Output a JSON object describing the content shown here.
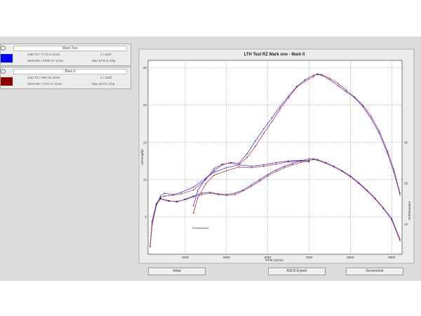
{
  "legend": [
    {
      "title": "Mark Two",
      "line1": "23577S / 77.41 5 1/min",
      "line1_right": "1 / 1027",
      "line2": "3578 Min / kW/h 97 1/min",
      "line2_right": "Max 5/7/4 9 1/hp",
      "color": "#0000ff"
    },
    {
      "title": "Mark II",
      "line1": "34177S / 79/2 05 1/min",
      "line1_right": "1 / 1025",
      "line2": "3578 Min / 77/2 17 1/min",
      "line2_right": "Max 8/27/1 1/hp",
      "color": "#8b0000"
    }
  ],
  "buttons": {
    "initial": "Initial",
    "ascii": "ASCII Export",
    "screenshot": "Screenshot"
  },
  "chart_data": {
    "type": "line",
    "title": "LTH Test RZ Mark one - Mark II",
    "xlabel": "RPM (1/min)",
    "ylabel": "Leistung/hp",
    "ylabel_right": "Drehmoment",
    "annotation": "Drehmoment",
    "xlim": [
      3100,
      9250
    ],
    "ylim": [
      0,
      26
    ],
    "x_ticks": [
      4000,
      5000,
      6000,
      7000,
      8000,
      9000
    ],
    "y_ticks": [
      5,
      10,
      15,
      20,
      25
    ],
    "y_tick_labels": [
      "5",
      "10",
      "15",
      "20",
      "25"
    ],
    "y_right_ticks": [
      4,
      9.5,
      15
    ],
    "y_right_tick_labels": [
      "10",
      "20",
      "30"
    ],
    "grid": true,
    "series": [
      {
        "color": "#3b3bff",
        "x": [
          3150,
          3200,
          3300,
          3400,
          3500,
          3700,
          3900,
          4200,
          4500,
          4700,
          4900,
          5100,
          5300,
          5500,
          5700,
          5900,
          6100,
          6300,
          6500,
          6700,
          6900,
          7100,
          7200,
          7300,
          7500,
          7700,
          7900,
          8100,
          8300,
          8500,
          8700,
          8900,
          9050,
          9200
        ],
        "y": [
          1,
          4,
          6.5,
          7.8,
          8.2,
          8.0,
          8.3,
          9.0,
          10.2,
          11.2,
          12.0,
          12.3,
          12.2,
          13.5,
          15.2,
          16.8,
          18.3,
          19.8,
          21.2,
          22.5,
          23.4,
          24.0,
          24.1,
          24.0,
          23.4,
          22.6,
          21.8,
          21.0,
          19.8,
          18.2,
          16.2,
          13.5,
          11.0,
          8.0
        ]
      },
      {
        "color": "#cc3333",
        "x": [
          3150,
          3200,
          3300,
          3400,
          3500,
          3700,
          3900,
          4200,
          4500,
          4700,
          4900,
          5100,
          5300,
          5500,
          5700,
          5900,
          6100,
          6300,
          6500,
          6700,
          6900,
          7100,
          7200,
          7300,
          7500,
          7700,
          7900,
          8100,
          8300,
          8500,
          8700,
          8900,
          9050,
          9200
        ],
        "y": [
          1,
          4.2,
          6.8,
          7.6,
          7.8,
          7.9,
          8.1,
          8.6,
          10.0,
          11.5,
          12.1,
          12.2,
          12.0,
          13.0,
          14.5,
          16.2,
          17.8,
          19.5,
          21.0,
          22.4,
          23.2,
          23.8,
          24.2,
          24.1,
          23.6,
          22.9,
          22.0,
          21.1,
          20.0,
          18.5,
          16.5,
          13.8,
          11.4,
          8.2
        ]
      },
      {
        "color": "#3b3bff",
        "x": [
          3150,
          3200,
          3300,
          3400,
          3600,
          3800,
          4000,
          4200,
          4400,
          4600,
          4800,
          5000,
          5200,
          5400,
          5600,
          5800,
          6000,
          6200,
          6400,
          6600,
          6800,
          7000,
          7100,
          7200,
          7400,
          7600,
          7800,
          8000,
          8200,
          8400,
          8600,
          8800,
          9000,
          9200
        ],
        "y": [
          1,
          4.5,
          6.8,
          7.5,
          7.2,
          7.0,
          7.4,
          7.8,
          8.2,
          8.3,
          8.1,
          8.0,
          8.2,
          8.6,
          9.3,
          10.0,
          10.7,
          11.3,
          11.8,
          12.2,
          12.5,
          12.8,
          12.8,
          12.7,
          12.3,
          11.8,
          11.2,
          10.5,
          9.6,
          8.6,
          7.5,
          6.2,
          4.8,
          2.0
        ]
      },
      {
        "color": "#cc3333",
        "x": [
          3150,
          3200,
          3300,
          3400,
          3600,
          3800,
          4000,
          4200,
          4400,
          4600,
          4800,
          5000,
          5200,
          5400,
          5600,
          5800,
          6000,
          6200,
          6400,
          6600,
          6800,
          7000,
          7100,
          7200,
          7400,
          7600,
          7800,
          8000,
          8200,
          8400,
          8600,
          8800,
          9000,
          9200
        ],
        "y": [
          1,
          4.3,
          6.6,
          7.4,
          7.1,
          7.1,
          7.3,
          7.7,
          8.0,
          8.2,
          8.0,
          7.9,
          8.0,
          8.5,
          9.1,
          9.8,
          10.5,
          11.1,
          11.6,
          12.0,
          12.3,
          12.6,
          12.7,
          12.6,
          12.2,
          11.7,
          11.1,
          10.4,
          9.5,
          8.5,
          7.4,
          6.1,
          4.6,
          1.8
        ]
      },
      {
        "color": "#3b3bff",
        "x": [
          4200,
          4300,
          4500,
          4700,
          5000,
          5300,
          5600,
          5900,
          6200,
          6500,
          6800,
          7000
        ],
        "y": [
          6.5,
          8.5,
          10.2,
          11.0,
          11.6,
          12.0,
          11.8,
          12.0,
          12.3,
          12.5,
          12.6,
          12.5
        ]
      },
      {
        "color": "#cc3333",
        "x": [
          4200,
          4300,
          4500,
          4700,
          5000,
          5300,
          5600,
          5900,
          6200,
          6500,
          6800,
          7000
        ],
        "y": [
          5.5,
          7.5,
          9.5,
          10.6,
          11.2,
          11.7,
          11.6,
          11.8,
          12.1,
          12.4,
          12.5,
          12.4
        ]
      }
    ]
  }
}
